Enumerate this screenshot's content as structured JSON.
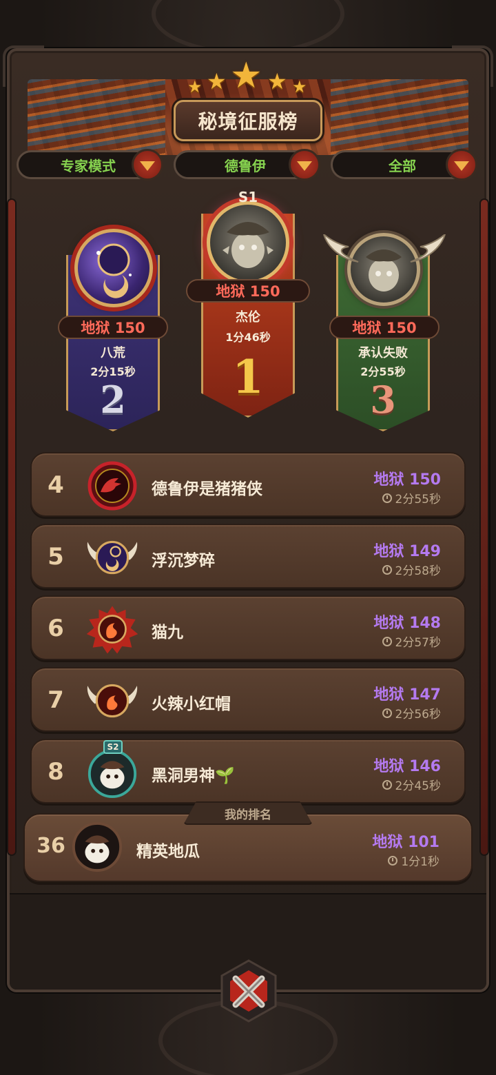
{
  "title": "秘境征服榜",
  "filters": [
    {
      "label": "专家模式"
    },
    {
      "label": "德鲁伊"
    },
    {
      "label": "全部"
    }
  ],
  "podium": [
    {
      "rank": "1",
      "season": "S1",
      "score": "地狱 150",
      "name": "杰伦",
      "time": "1分46秒",
      "color": "#b8391f"
    },
    {
      "rank": "2",
      "score": "地狱 150",
      "name": "八荒",
      "time": "2分15秒",
      "color": "#4a3a8a"
    },
    {
      "rank": "3",
      "score": "地狱 150",
      "name": "承认失败",
      "time": "2分55秒",
      "color": "#3f6a35"
    }
  ],
  "rows": [
    {
      "rank": "4",
      "name": "德鲁伊是猪猪侠",
      "score": "地狱 150",
      "time": "2分55秒",
      "emblem": "dragon-emblem"
    },
    {
      "rank": "5",
      "name": "浮沉梦碎",
      "score": "地狱 149",
      "time": "2分58秒",
      "emblem": "moon-emblem"
    },
    {
      "rank": "6",
      "name": "猫九",
      "score": "地狱 148",
      "time": "2分57秒",
      "emblem": "fire-emblem"
    },
    {
      "rank": "7",
      "name": "火辣小红帽",
      "score": "地狱 147",
      "time": "2分56秒",
      "emblem": "fire-wing-emblem"
    },
    {
      "rank": "8",
      "name": "黑洞男神🌱",
      "score": "地狱 146",
      "time": "2分45秒",
      "emblem": "druid-avatar",
      "season": "S2"
    }
  ],
  "my_rank": {
    "tag": "我的排名",
    "rank": "36",
    "name": "精英地瓜",
    "score": "地狱 101",
    "time": "1分1秒"
  },
  "colors": {
    "score_purple": "#b47af0",
    "score_red": "#ff6a5a",
    "filter_green": "#86d24f",
    "gold": "#f2b53a"
  }
}
